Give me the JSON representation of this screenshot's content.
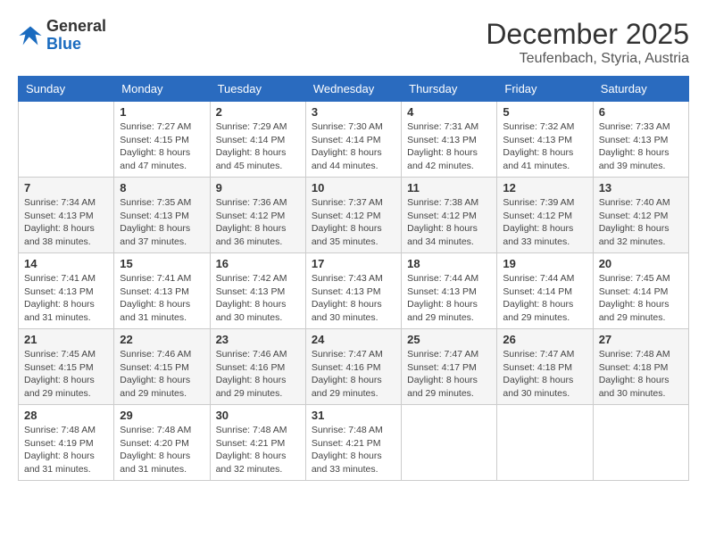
{
  "logo": {
    "general": "General",
    "blue": "Blue"
  },
  "title": {
    "month_year": "December 2025",
    "location": "Teufenbach, Styria, Austria"
  },
  "days_of_week": [
    "Sunday",
    "Monday",
    "Tuesday",
    "Wednesday",
    "Thursday",
    "Friday",
    "Saturday"
  ],
  "weeks": [
    [
      {
        "day": "",
        "info": ""
      },
      {
        "day": "1",
        "info": "Sunrise: 7:27 AM\nSunset: 4:15 PM\nDaylight: 8 hours\nand 47 minutes."
      },
      {
        "day": "2",
        "info": "Sunrise: 7:29 AM\nSunset: 4:14 PM\nDaylight: 8 hours\nand 45 minutes."
      },
      {
        "day": "3",
        "info": "Sunrise: 7:30 AM\nSunset: 4:14 PM\nDaylight: 8 hours\nand 44 minutes."
      },
      {
        "day": "4",
        "info": "Sunrise: 7:31 AM\nSunset: 4:13 PM\nDaylight: 8 hours\nand 42 minutes."
      },
      {
        "day": "5",
        "info": "Sunrise: 7:32 AM\nSunset: 4:13 PM\nDaylight: 8 hours\nand 41 minutes."
      },
      {
        "day": "6",
        "info": "Sunrise: 7:33 AM\nSunset: 4:13 PM\nDaylight: 8 hours\nand 39 minutes."
      }
    ],
    [
      {
        "day": "7",
        "info": "Sunrise: 7:34 AM\nSunset: 4:13 PM\nDaylight: 8 hours\nand 38 minutes."
      },
      {
        "day": "8",
        "info": "Sunrise: 7:35 AM\nSunset: 4:13 PM\nDaylight: 8 hours\nand 37 minutes."
      },
      {
        "day": "9",
        "info": "Sunrise: 7:36 AM\nSunset: 4:12 PM\nDaylight: 8 hours\nand 36 minutes."
      },
      {
        "day": "10",
        "info": "Sunrise: 7:37 AM\nSunset: 4:12 PM\nDaylight: 8 hours\nand 35 minutes."
      },
      {
        "day": "11",
        "info": "Sunrise: 7:38 AM\nSunset: 4:12 PM\nDaylight: 8 hours\nand 34 minutes."
      },
      {
        "day": "12",
        "info": "Sunrise: 7:39 AM\nSunset: 4:12 PM\nDaylight: 8 hours\nand 33 minutes."
      },
      {
        "day": "13",
        "info": "Sunrise: 7:40 AM\nSunset: 4:12 PM\nDaylight: 8 hours\nand 32 minutes."
      }
    ],
    [
      {
        "day": "14",
        "info": "Sunrise: 7:41 AM\nSunset: 4:13 PM\nDaylight: 8 hours\nand 31 minutes."
      },
      {
        "day": "15",
        "info": "Sunrise: 7:41 AM\nSunset: 4:13 PM\nDaylight: 8 hours\nand 31 minutes."
      },
      {
        "day": "16",
        "info": "Sunrise: 7:42 AM\nSunset: 4:13 PM\nDaylight: 8 hours\nand 30 minutes."
      },
      {
        "day": "17",
        "info": "Sunrise: 7:43 AM\nSunset: 4:13 PM\nDaylight: 8 hours\nand 30 minutes."
      },
      {
        "day": "18",
        "info": "Sunrise: 7:44 AM\nSunset: 4:13 PM\nDaylight: 8 hours\nand 29 minutes."
      },
      {
        "day": "19",
        "info": "Sunrise: 7:44 AM\nSunset: 4:14 PM\nDaylight: 8 hours\nand 29 minutes."
      },
      {
        "day": "20",
        "info": "Sunrise: 7:45 AM\nSunset: 4:14 PM\nDaylight: 8 hours\nand 29 minutes."
      }
    ],
    [
      {
        "day": "21",
        "info": "Sunrise: 7:45 AM\nSunset: 4:15 PM\nDaylight: 8 hours\nand 29 minutes."
      },
      {
        "day": "22",
        "info": "Sunrise: 7:46 AM\nSunset: 4:15 PM\nDaylight: 8 hours\nand 29 minutes."
      },
      {
        "day": "23",
        "info": "Sunrise: 7:46 AM\nSunset: 4:16 PM\nDaylight: 8 hours\nand 29 minutes."
      },
      {
        "day": "24",
        "info": "Sunrise: 7:47 AM\nSunset: 4:16 PM\nDaylight: 8 hours\nand 29 minutes."
      },
      {
        "day": "25",
        "info": "Sunrise: 7:47 AM\nSunset: 4:17 PM\nDaylight: 8 hours\nand 29 minutes."
      },
      {
        "day": "26",
        "info": "Sunrise: 7:47 AM\nSunset: 4:18 PM\nDaylight: 8 hours\nand 30 minutes."
      },
      {
        "day": "27",
        "info": "Sunrise: 7:48 AM\nSunset: 4:18 PM\nDaylight: 8 hours\nand 30 minutes."
      }
    ],
    [
      {
        "day": "28",
        "info": "Sunrise: 7:48 AM\nSunset: 4:19 PM\nDaylight: 8 hours\nand 31 minutes."
      },
      {
        "day": "29",
        "info": "Sunrise: 7:48 AM\nSunset: 4:20 PM\nDaylight: 8 hours\nand 31 minutes."
      },
      {
        "day": "30",
        "info": "Sunrise: 7:48 AM\nSunset: 4:21 PM\nDaylight: 8 hours\nand 32 minutes."
      },
      {
        "day": "31",
        "info": "Sunrise: 7:48 AM\nSunset: 4:21 PM\nDaylight: 8 hours\nand 33 minutes."
      },
      {
        "day": "",
        "info": ""
      },
      {
        "day": "",
        "info": ""
      },
      {
        "day": "",
        "info": ""
      }
    ]
  ]
}
